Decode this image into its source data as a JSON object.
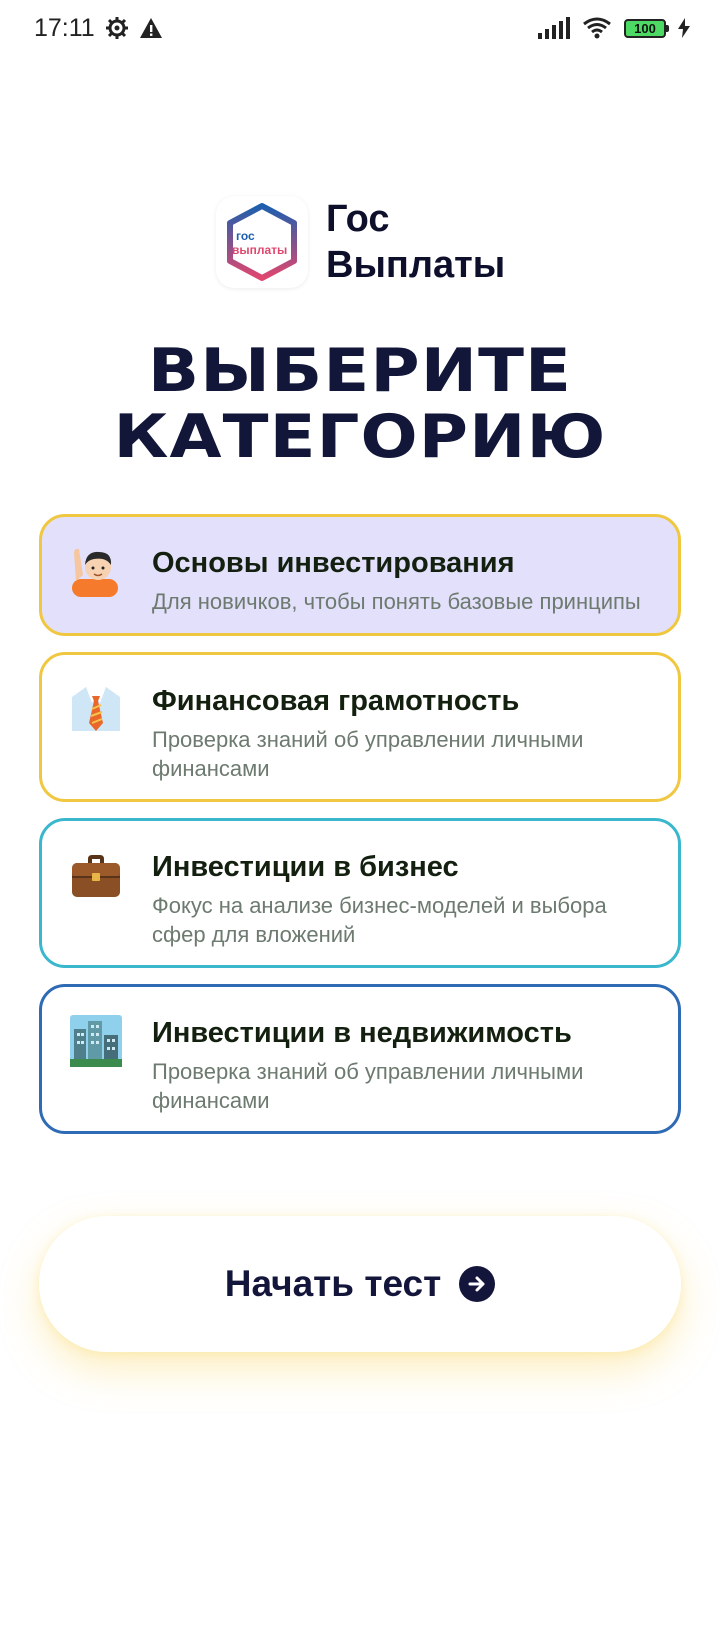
{
  "status_bar": {
    "time": "17:11",
    "battery": "100"
  },
  "brand": {
    "logo_text_top": "гос",
    "logo_text_bottom": "выплаты",
    "name_line1": "Гос",
    "name_line2": "Выплаты"
  },
  "headline": {
    "line1": "ВЫБЕРИТЕ",
    "line2": "КАТЕГОРИЮ"
  },
  "categories": [
    {
      "title": "Основы инвестирования",
      "description": "Для новичков, чтобы понять базовые принципы",
      "icon": "raising-hand-person-icon",
      "border_color": "#f0c740",
      "selected": true
    },
    {
      "title": "Финансовая грамотность",
      "description": "Проверка знаний об управлении личными финансами",
      "icon": "shirt-tie-icon",
      "border_color": "#f0c740",
      "selected": false
    },
    {
      "title": "Инвестиции в бизнес",
      "description": "Фокус на анализе бизнес-моделей и выбора сфер для вложений",
      "icon": "briefcase-icon",
      "border_color": "#3ab7cc",
      "selected": false
    },
    {
      "title": "Инвестиции в недвижимость",
      "description": "Проверка знаний об управлении личными финансами",
      "icon": "city-buildings-icon",
      "border_color": "#2f6bb5",
      "selected": false
    }
  ],
  "start_button": {
    "label": "Начать тест",
    "icon": "arrow-right-circle-icon"
  },
  "colors": {
    "accent_dark": "#13163a",
    "selected_bg": "#e3e0fb"
  }
}
